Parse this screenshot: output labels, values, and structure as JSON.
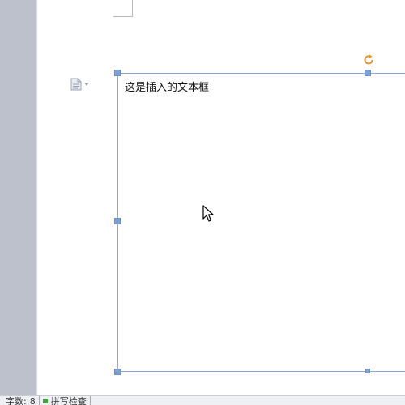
{
  "document": {
    "textbox_text": "这是插入的文本框"
  },
  "status_bar": {
    "word_count_label": "字数:",
    "word_count_value": "8",
    "spell_check_label": "拼写检查"
  },
  "icons": {
    "paste_options": "paste-options-icon",
    "rotate_handle": "rotate-icon",
    "pointer": "mouse-cursor-icon"
  },
  "colors": {
    "gutter": "#bdc1cc",
    "textbox_border": "#8ea9d6",
    "handle": "#7aa0d6",
    "rotate_handle": "#e8942a",
    "spell_check_indicator": "#41a33a"
  }
}
